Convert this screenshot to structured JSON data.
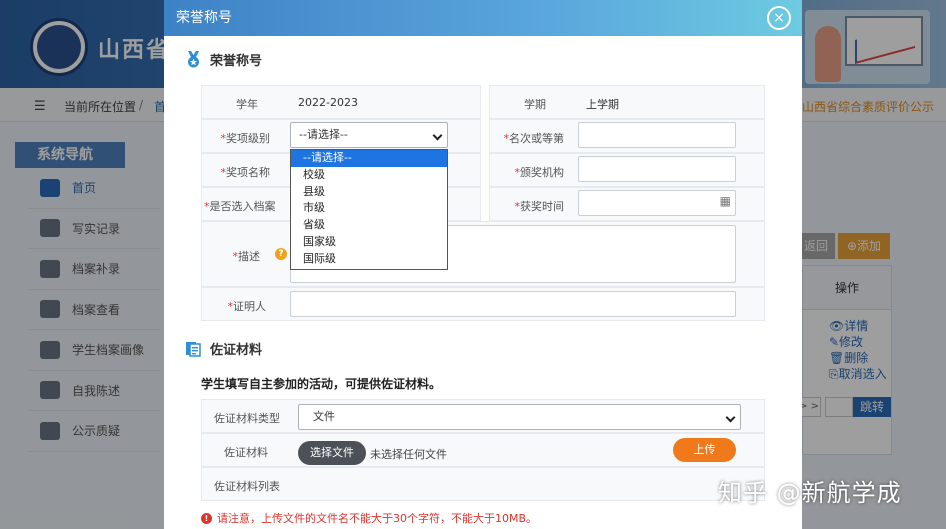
{
  "background": {
    "site_title": "山西省",
    "breadcrumb": {
      "location_label": "当前所在位置",
      "separator": "/",
      "crumb2": "首",
      "right_link": "山西省综合素质评价公示"
    },
    "nav_title": "系统导航",
    "nav_items": [
      "首页",
      "写实记录",
      "档案补录",
      "档案查看",
      "学生档案画像",
      "自我陈述",
      "公示质疑"
    ],
    "buttons": {
      "back": "返回",
      "add": "⊕添加"
    },
    "table": {
      "header": "操作",
      "actions": [
        "👁详情",
        "✎修改",
        "🗑删除",
        "⎘取消选入"
      ]
    },
    "pager": {
      "next": "> >",
      "jump": "跳转"
    },
    "watermark": "知乎 @新航学成"
  },
  "modal": {
    "title": "荣誉称号",
    "close_icon": "×",
    "section1_title": "荣誉称号",
    "fields": {
      "year_label": "学年",
      "year_value": "2022-2023",
      "term_label": "学期",
      "term_value": "上学期",
      "level_label": "奖项级别",
      "level_selected": "--请选择--",
      "rank_label": "名次或等第",
      "name_label": "奖项名称",
      "org_label": "颁奖机构",
      "archive_label": "是否选入档案",
      "time_label": "获奖时间",
      "desc_label": "描述",
      "witness_label": "证明人",
      "required_mark": "*"
    },
    "level_options": [
      "--请选择--",
      "校级",
      "县级",
      "市级",
      "省级",
      "国家级",
      "国际级"
    ],
    "section2_title": "佐证材料",
    "evidence_note": "学生填写自主参加的活动，可提供佐证材料。",
    "evidence": {
      "type_label": "佐证材料类型",
      "type_value": "文件",
      "file_label": "佐证材料",
      "choose_file": "选择文件",
      "no_file": "未选择任何文件",
      "upload": "上传",
      "list_label": "佐证材料列表"
    },
    "warning": "请注意，上传文件的文件名不能大于30个字符，不能大于10MB。",
    "help_icon": "?",
    "calendar_icon": "▦"
  },
  "colors": {
    "header_start": "#3e82c6",
    "header_end": "#6dcbe0",
    "upload": "#f07a1b",
    "required": "#e0332c",
    "selected": "#1e74e0"
  }
}
